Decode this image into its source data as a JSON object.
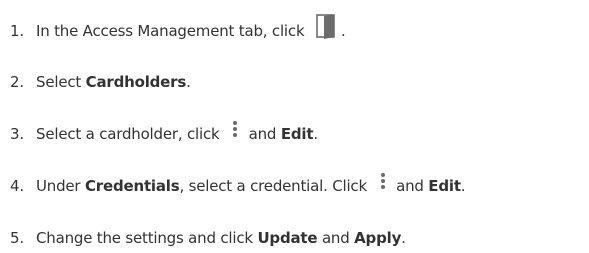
{
  "steps": [
    {
      "number": "1.",
      "parts": [
        {
          "type": "text",
          "text": "In the Access Management tab, click "
        },
        {
          "type": "icon",
          "icon": "door-icon"
        },
        {
          "type": "text",
          "text": "."
        }
      ]
    },
    {
      "number": "2.",
      "parts": [
        {
          "type": "text",
          "text": "Select "
        },
        {
          "type": "bold",
          "text": "Cardholders"
        },
        {
          "type": "text",
          "text": "."
        }
      ]
    },
    {
      "number": "3.",
      "parts": [
        {
          "type": "text",
          "text": "Select a cardholder, click "
        },
        {
          "type": "icon",
          "icon": "more-vertical-icon"
        },
        {
          "type": "text",
          "text": " and "
        },
        {
          "type": "bold",
          "text": "Edit"
        },
        {
          "type": "text",
          "text": "."
        }
      ]
    },
    {
      "number": "4.",
      "parts": [
        {
          "type": "text",
          "text": "Under "
        },
        {
          "type": "bold",
          "text": "Credentials"
        },
        {
          "type": "text",
          "text": ", select a credential. Click "
        },
        {
          "type": "icon",
          "icon": "more-vertical-icon"
        },
        {
          "type": "text",
          "text": " and "
        },
        {
          "type": "bold",
          "text": "Edit"
        },
        {
          "type": "text",
          "text": "."
        }
      ]
    },
    {
      "number": "5.",
      "parts": [
        {
          "type": "text",
          "text": "Change the settings and click "
        },
        {
          "type": "bold",
          "text": "Update"
        },
        {
          "type": "text",
          "text": " and "
        },
        {
          "type": "bold",
          "text": "Apply"
        },
        {
          "type": "text",
          "text": "."
        }
      ]
    }
  ],
  "colors": {
    "text": "#333333",
    "icon": "#6b6b6b",
    "background": "#ffffff"
  }
}
